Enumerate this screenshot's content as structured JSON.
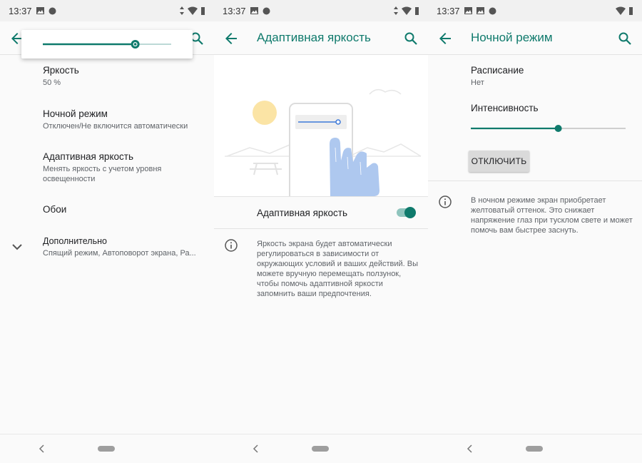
{
  "status": {
    "time": "13:37"
  },
  "colors": {
    "accent": "#0f7a6c",
    "illustration": "#aec8ef",
    "sun": "#fbe4a5"
  },
  "screen1": {
    "brightness_fraction": 0.72,
    "items": [
      {
        "title": "Яркость",
        "subtitle": "50 %"
      },
      {
        "title": "Ночной режим",
        "subtitle": "Отключен/Не включится автоматически"
      },
      {
        "title": "Адаптивная яркость",
        "subtitle": "Менять яркость с учетом уровня освещенности"
      },
      {
        "title": "Обои",
        "subtitle": ""
      },
      {
        "title": "Дополнительно",
        "subtitle": "Спящий режим, Автоповорот экрана, Ра..."
      }
    ]
  },
  "screen2": {
    "title": "Адаптивная яркость",
    "toggle_label": "Адаптивная яркость",
    "toggle_on": true,
    "info": "Яркость экрана будет автоматически регулироваться в зависимости от окружающих условий и ваших действий. Вы можете вручную перемещать ползунок, чтобы помочь адаптивной яркости запомнить ваши предпочтения."
  },
  "screen3": {
    "title": "Ночной режим",
    "schedule_label": "Расписание",
    "schedule_value": "Нет",
    "intensity_label": "Интенсивность",
    "intensity_fraction": 0.565,
    "button_label": "ОТКЛЮЧИТЬ",
    "info": "В ночном режиме экран приобретает желтоватый оттенок. Это снижает напряжение глаз при тусклом свете и может помочь вам быстрее заснуть."
  }
}
